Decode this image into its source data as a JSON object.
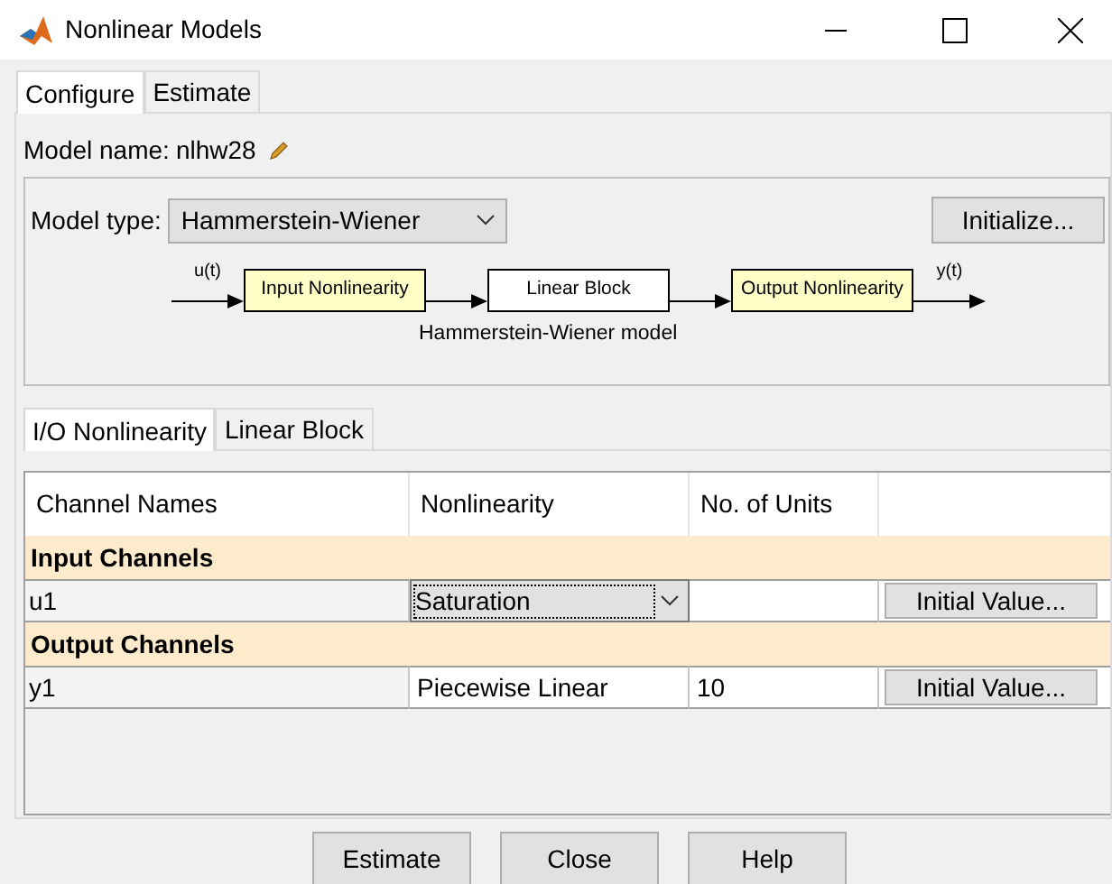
{
  "window": {
    "title": "Nonlinear Models"
  },
  "tabs": [
    {
      "label": "Configure",
      "selected": true
    },
    {
      "label": "Estimate",
      "selected": false
    }
  ],
  "model_name": {
    "label": "Model name:",
    "value": "nlhw28"
  },
  "model_type": {
    "label": "Model type:",
    "value": "Hammerstein-Wiener"
  },
  "initialize_button": "Initialize...",
  "diagram": {
    "input_signal": "u(t)",
    "output_signal": "y(t)",
    "caption": "Hammerstein-Wiener model",
    "blocks": [
      {
        "label": "Input Nonlinearity",
        "highlighted": true
      },
      {
        "label": "Linear Block",
        "highlighted": false
      },
      {
        "label": "Output Nonlinearity",
        "highlighted": true
      }
    ]
  },
  "sub_tabs": [
    {
      "label": "I/O Nonlinearity",
      "selected": true
    },
    {
      "label": "Linear Block",
      "selected": false
    }
  ],
  "table": {
    "columns": [
      "Channel Names",
      "Nonlinearity",
      "No. of Units"
    ],
    "groups": [
      {
        "label": "Input Channels",
        "rows": [
          {
            "name": "u1",
            "nonlinearity": "Saturation",
            "kind": "dropdown",
            "button": "Initial Value..."
          }
        ]
      },
      {
        "label": "Output Channels",
        "rows": [
          {
            "name": "y1",
            "nonlinearity": "Piecewise Linear",
            "kind": "text",
            "units": "10",
            "button": "Initial Value..."
          }
        ]
      }
    ]
  },
  "buttons": [
    "Estimate",
    "Close",
    "Help"
  ]
}
